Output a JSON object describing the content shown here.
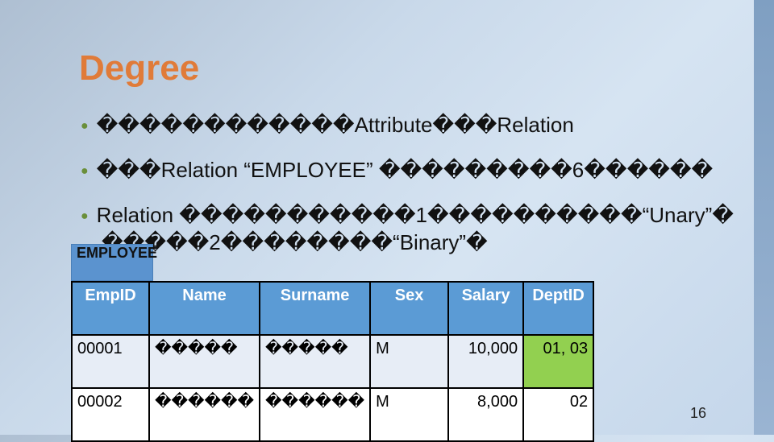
{
  "slide": {
    "title": "Degree",
    "bullets": [
      "������������Attribute���Relation",
      "���Relation “EMPLOYEE” ���������6������",
      "Relation �����������1����������“Unary”�",
      "�����2��������“Binary”�"
    ],
    "table_label": "EMPLOYEE",
    "table": {
      "headers": [
        "EmpID",
        "Name",
        "Surname",
        "Sex",
        "Salary",
        "DeptID"
      ],
      "rows": [
        [
          "00001",
          "�����",
          "�����",
          "M",
          "10,000",
          "01, 03"
        ],
        [
          "00002",
          "������",
          "������",
          "M",
          "8,000",
          "02"
        ]
      ]
    },
    "page_number": "16",
    "colors": {
      "title": "#e07b39",
      "header": "#5b9bd5",
      "highlight": "#92d050"
    }
  }
}
